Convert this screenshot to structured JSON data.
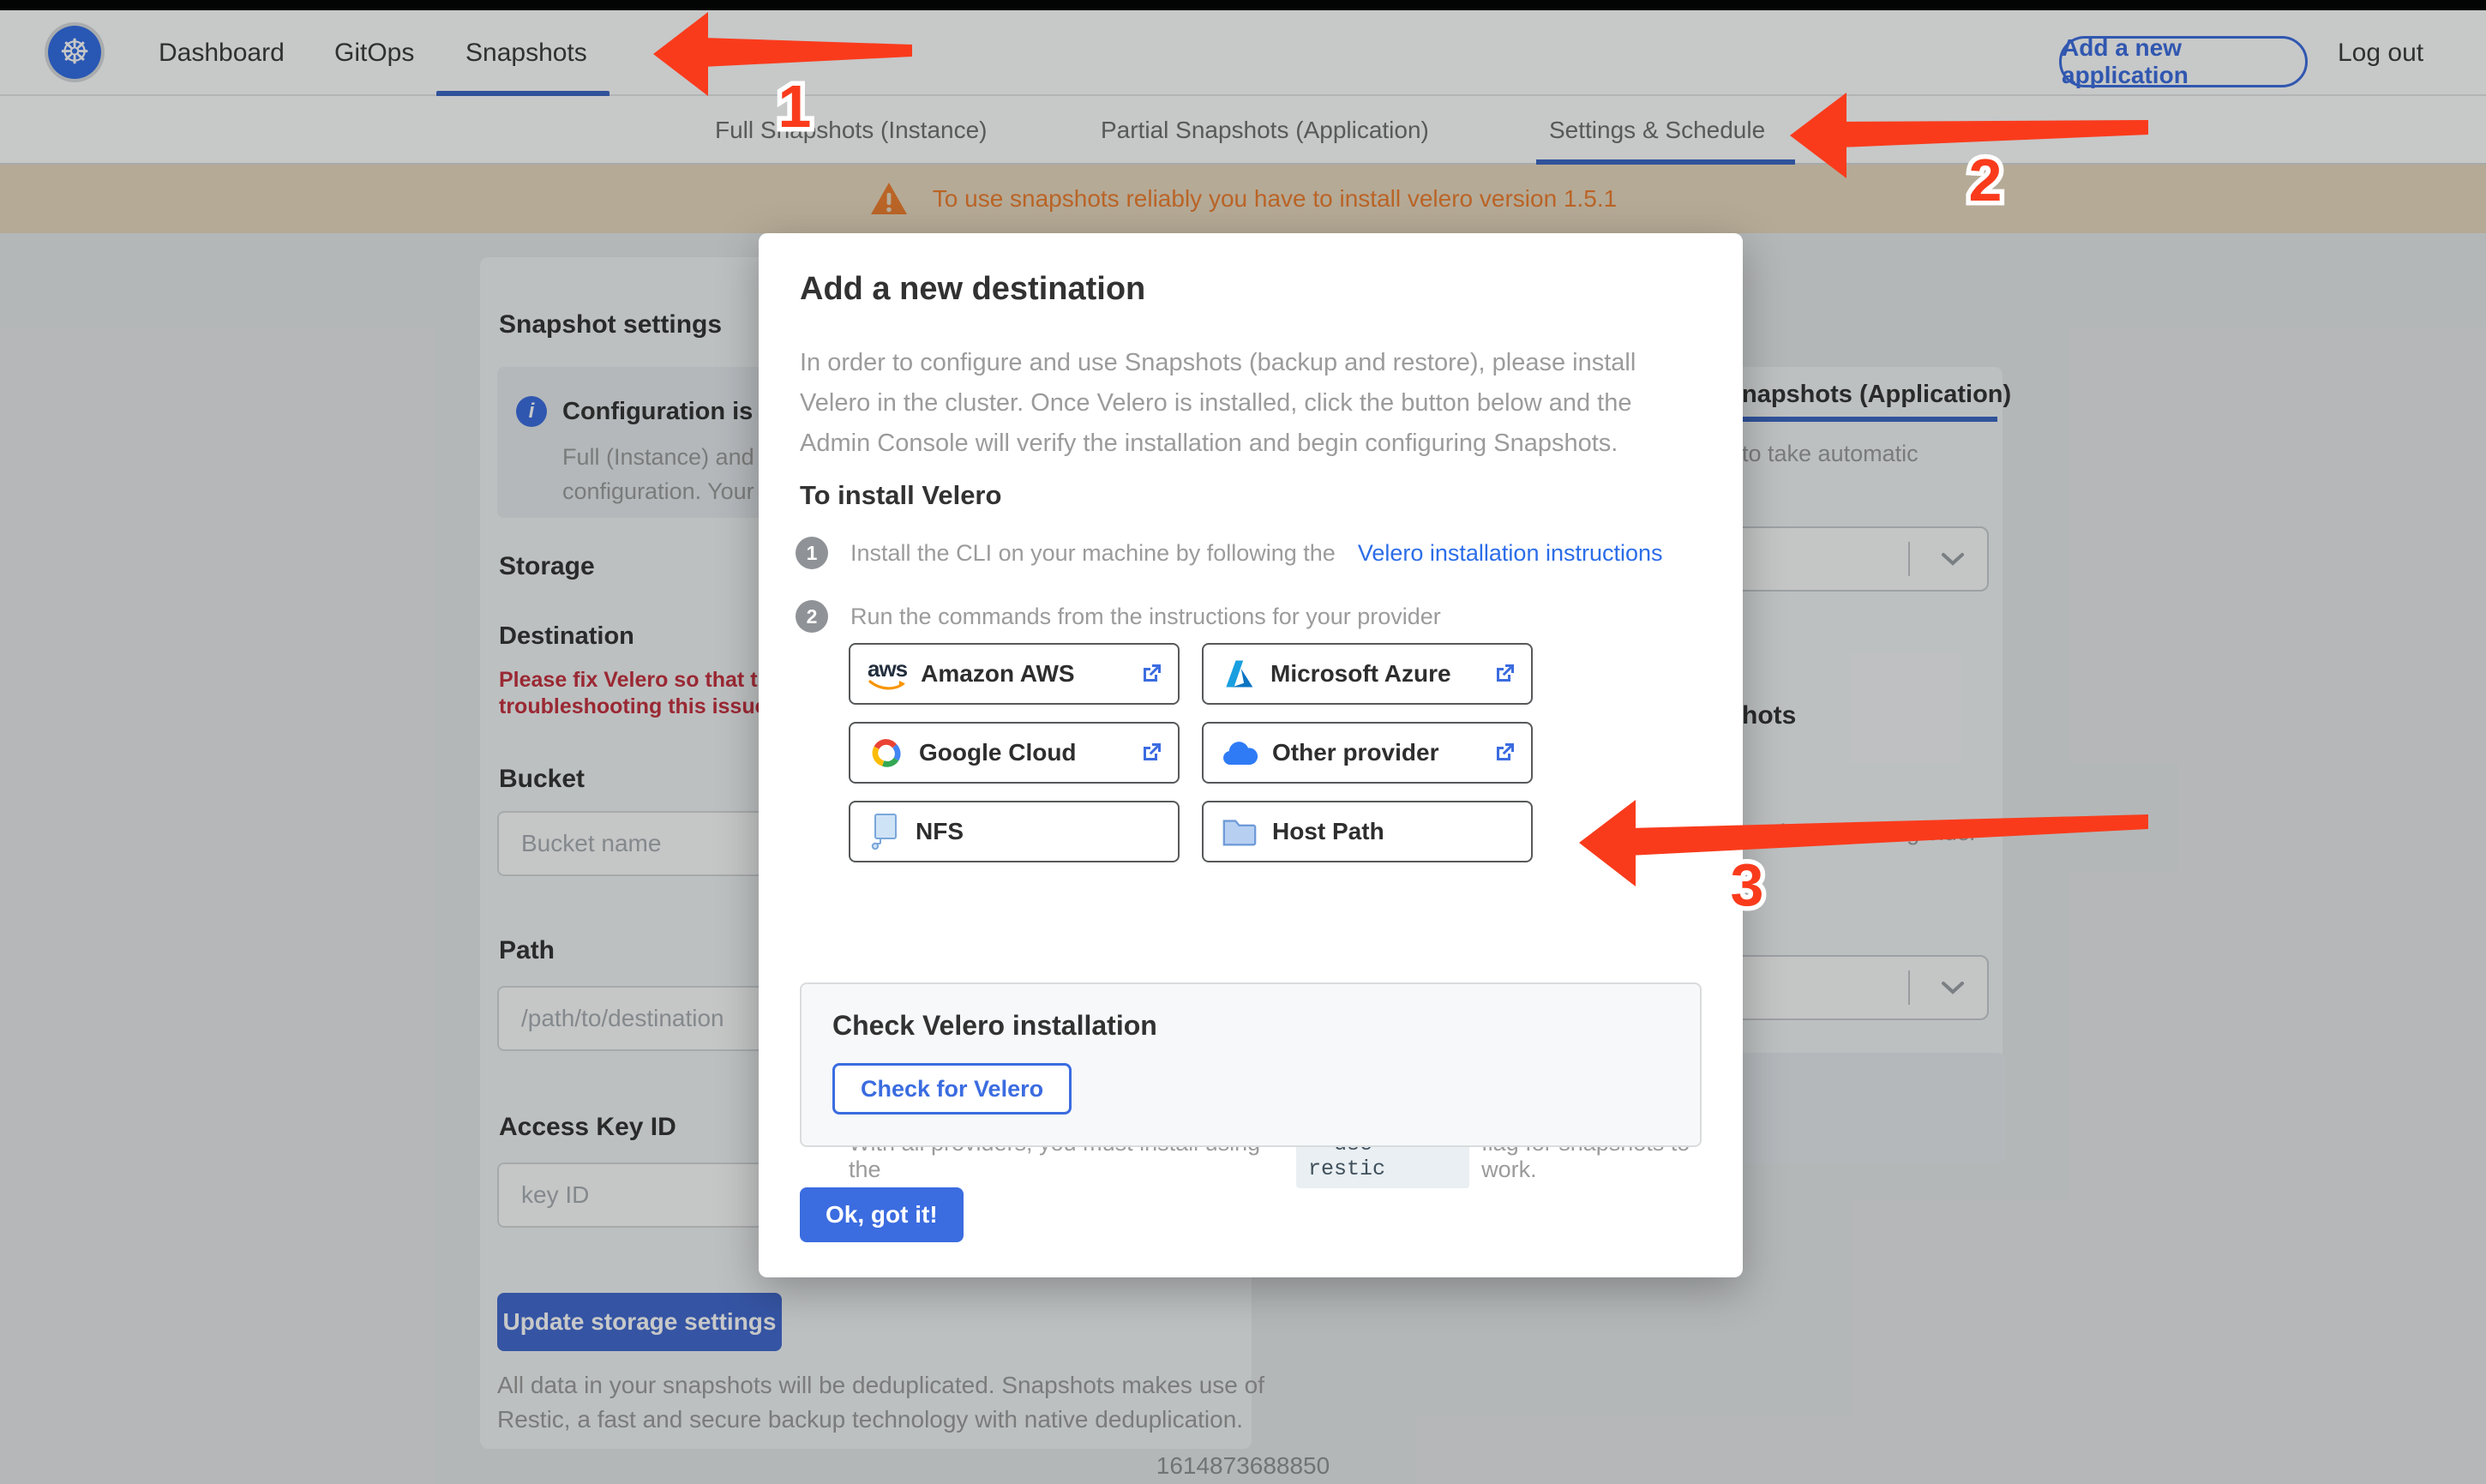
{
  "header": {
    "nav": [
      {
        "label": "Dashboard",
        "active": false
      },
      {
        "label": "GitOps",
        "active": false
      },
      {
        "label": "Snapshots",
        "active": true
      }
    ],
    "add_app_label": "Add a new application",
    "logout_label": "Log out"
  },
  "subnav": {
    "tabs": [
      {
        "label": "Full Snapshots (Instance)",
        "active": false
      },
      {
        "label": "Partial Snapshots (Application)",
        "active": false
      },
      {
        "label": "Settings & Schedule",
        "active": true
      }
    ]
  },
  "banner": {
    "text": "To use snapshots reliably you have to install velero version 1.5.1"
  },
  "left_panel": {
    "title": "Snapshot settings",
    "info_title_fragment": "Configuration is sh",
    "info_line1_fragment": "Full (Instance) and Parti",
    "info_line2_fragment": "configuration. Your stor",
    "storage_heading": "Storage",
    "destination_label": "Destination",
    "error_line1": "Please fix Velero so that th",
    "error_line2": "troubleshooting this issue",
    "bucket_label": "Bucket",
    "bucket_placeholder": "Bucket name",
    "path_label": "Path",
    "path_placeholder": "/path/to/destination",
    "access_key_label": "Access Key ID",
    "access_key_placeholder": "key ID",
    "update_button": "Update storage settings",
    "footer_line1": "All data in your snapshots will be deduplicated. Snapshots makes use of",
    "footer_line2": "Restic, a fast and secure backup technology with native deduplication."
  },
  "right_panel": {
    "tab_fragment": "napshots (Application)",
    "caption_fragment": "to take automatic",
    "heading_fragment": "hots",
    "caption2_fragment": "matically deleting older"
  },
  "modal": {
    "title": "Add a new destination",
    "description": "In order to configure and use Snapshots (backup and restore), please install Velero in the cluster. Once Velero is installed, click the button below and the Admin Console will verify the installation and begin configuring Snapshots.",
    "install_heading": "To install Velero",
    "step1_num": "1",
    "step1_text": "Install the CLI on your machine by following the",
    "step1_link": "Velero installation instructions",
    "step2_num": "2",
    "step2_text": "Run the commands from the instructions for your provider",
    "providers": [
      {
        "name": "Amazon AWS",
        "external": true
      },
      {
        "name": "Microsoft Azure",
        "external": true
      },
      {
        "name": "Google Cloud",
        "external": true
      },
      {
        "name": "Other provider",
        "external": true
      },
      {
        "name": "NFS",
        "external": false
      },
      {
        "name": "Host Path",
        "external": false
      }
    ],
    "restic_pre": "With all providers, you must install using the",
    "restic_code": "--use-restic",
    "restic_post": "flag for snapshots to work.",
    "check_section_title": "Check Velero installation",
    "check_button": "Check for Velero",
    "ok_button": "Ok, got it!"
  },
  "annotations": {
    "arrow1_label": "1",
    "arrow2_label": "2",
    "arrow3_label": "3"
  },
  "footer": {
    "timestamp": "1614873688850"
  },
  "colors": {
    "accent_blue": "#3b6ce0",
    "underline_blue": "#3b66c3",
    "arrow_red": "#f93b1c",
    "warning_orange": "#ee7d2e",
    "error_red": "#c5303e",
    "banner_bg": "#e8d9bf"
  }
}
